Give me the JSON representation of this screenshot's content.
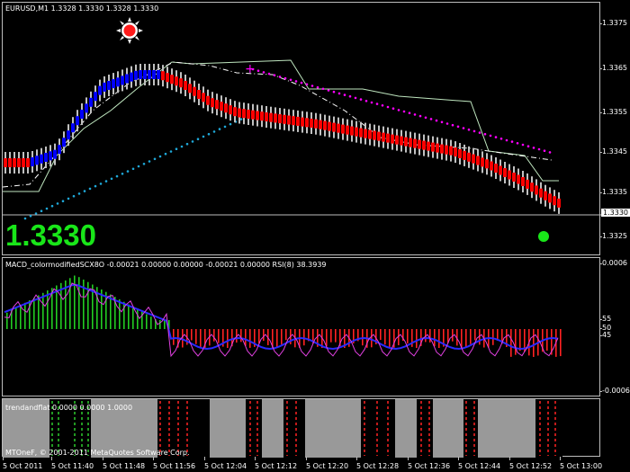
{
  "window": {
    "symbol_title": "EURUSD,M1  1.3328 1.3330 1.3328 1.3330"
  },
  "big_price": "1.3330",
  "price_marker": "1.3330",
  "price_axis": [
    "1.3375",
    "1.3365",
    "1.3355",
    "1.3345",
    "1.3335",
    "1.3325"
  ],
  "macd": {
    "title": "MACD_colormodifiedSCX8O -0.00021 0.00000 0.00000 -0.00021 0.00000  RSI(8) 38.3939",
    "axis": [
      "0.0006",
      "55",
      "50",
      "45",
      "-0.0006"
    ]
  },
  "trend": {
    "title": "trendandflat 0.0000 0.0000 1.0000"
  },
  "copyright": "MTOneF, © 2001-2011 MetaQuotes Software Corp.",
  "time_axis": [
    "5 Oct 2011",
    "5 Oct 11:40",
    "5 Oct 11:48",
    "5 Oct 11:56",
    "5 Oct 12:04",
    "5 Oct 12:12",
    "5 Oct 12:20",
    "5 Oct 12:28",
    "5 Oct 12:36",
    "5 Oct 12:44",
    "5 Oct 12:52",
    "5 Oct 13:00"
  ],
  "colors": {
    "up_bar": "#0000ff",
    "down_bar": "#ff0000",
    "neutral_bar": "#c0c0c0",
    "big_price": "#19e619",
    "magenta": "#ff00ff",
    "cyan": "#1fa8d8",
    "green_hist": "#22cc22",
    "red_hist": "#ff2222",
    "gray": "#999999"
  }
}
